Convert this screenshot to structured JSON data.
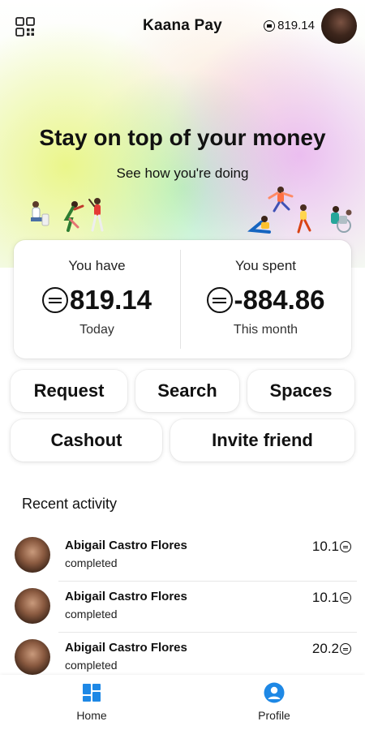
{
  "header": {
    "title": "Kaana Pay",
    "balance": "819.14",
    "icons": {
      "scan": "qr-scan-icon",
      "currency": "currency-icon",
      "avatar": "avatar"
    }
  },
  "hero": {
    "title": "Stay on top of your money",
    "subtitle": "See how you're doing"
  },
  "summary": {
    "have": {
      "label": "You have",
      "amount": "819.14",
      "note": "Today"
    },
    "spent": {
      "label": "You spent",
      "amount": "-884.86",
      "note": "This month"
    }
  },
  "actions": {
    "request": "Request",
    "search": "Search",
    "spaces": "Spaces",
    "cashout": "Cashout",
    "invite": "Invite friend"
  },
  "activity": {
    "title": "Recent activity",
    "items": [
      {
        "name": "Abigail Castro Flores",
        "status": "completed",
        "amount": "10.1"
      },
      {
        "name": "Abigail Castro Flores",
        "status": "completed",
        "amount": "10.1"
      },
      {
        "name": "Abigail Castro Flores",
        "status": "completed",
        "amount": "20.2"
      }
    ]
  },
  "nav": {
    "home": {
      "label": "Home",
      "icon": "dashboard-icon"
    },
    "profile": {
      "label": "Profile",
      "icon": "person-icon"
    }
  },
  "colors": {
    "accent": "#1e88e5",
    "text": "#111111"
  }
}
